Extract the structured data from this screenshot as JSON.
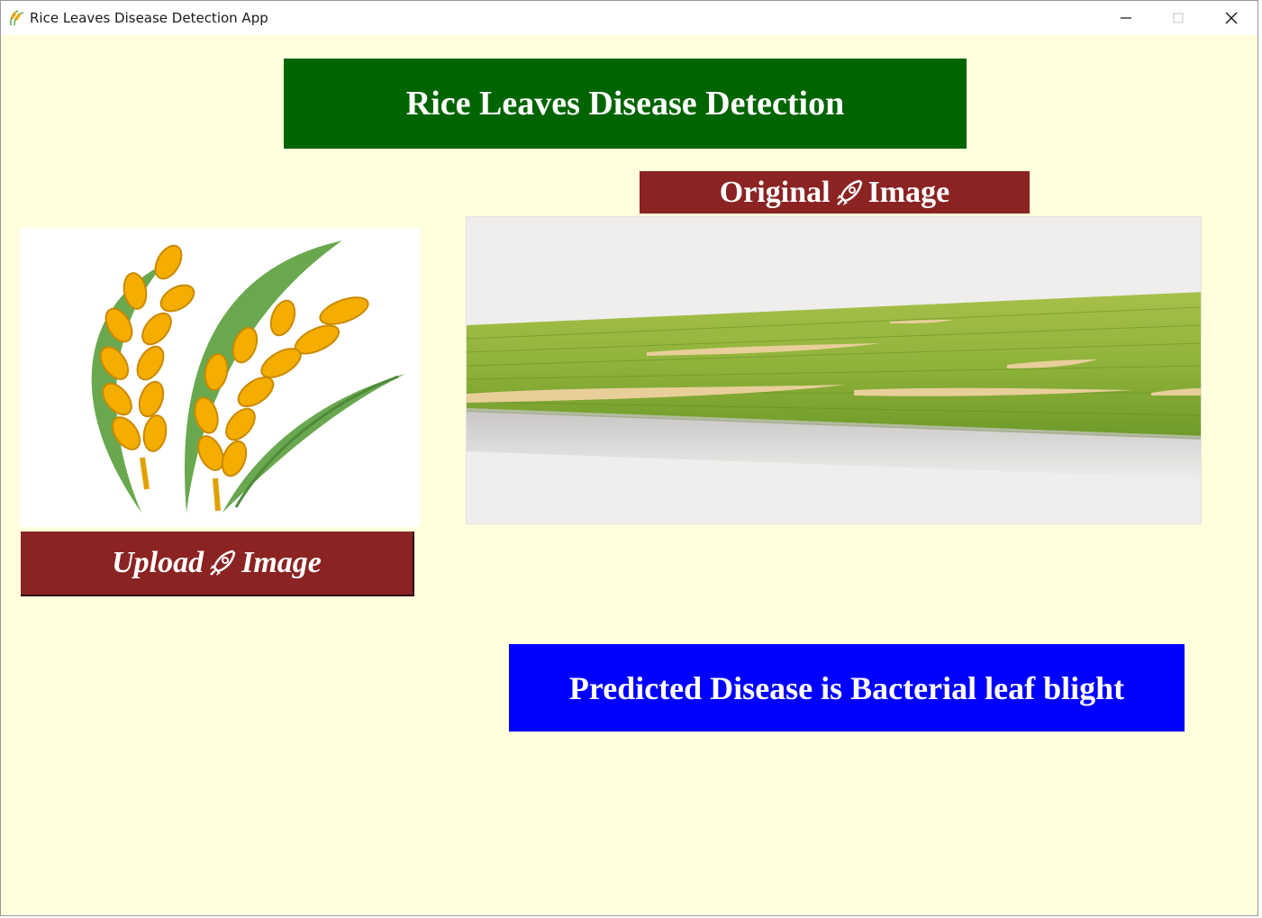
{
  "window": {
    "title": "Rice Leaves Disease Detection App",
    "icon": "rice-plant-icon",
    "controls": [
      "minimize-icon",
      "maximize-icon",
      "close-icon"
    ]
  },
  "header": {
    "title": "Rice Leaves Disease Detection"
  },
  "upload": {
    "label_before": "Upload",
    "label_after": "Image",
    "icon": "rocket-icon"
  },
  "original": {
    "label_before": "Original",
    "label_after": "Image",
    "icon": "rocket-icon"
  },
  "result": {
    "text": "Predicted Disease is Bacterial leaf blight"
  },
  "colors": {
    "background": "#fffedd",
    "header_bg": "#006400",
    "button_bg": "#8b2323",
    "result_bg": "#0000ff",
    "text": "#ffffff"
  }
}
